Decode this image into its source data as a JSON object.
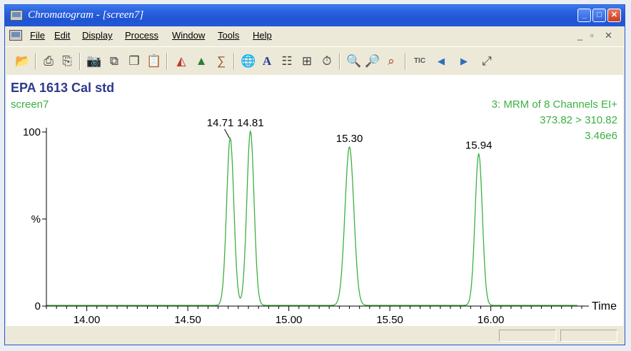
{
  "window": {
    "title": "Chromatogram - [screen7]"
  },
  "menu": [
    "File",
    "Edit",
    "Display",
    "Process",
    "Window",
    "Tools",
    "Help"
  ],
  "toolbar": [
    {
      "icon": "open-folder-icon",
      "glyph": "📂"
    },
    {
      "icon": "print-icon",
      "glyph": "⎙"
    },
    {
      "icon": "print-preview-icon",
      "glyph": "⎘"
    },
    {
      "icon": "camera-icon",
      "glyph": "📷"
    },
    {
      "icon": "copy-icon",
      "glyph": "⧉"
    },
    {
      "icon": "copy-list-icon",
      "glyph": "❐"
    },
    {
      "icon": "paste-icon",
      "glyph": "📋"
    },
    {
      "icon": "chromatogram-icon",
      "glyph": "◭"
    },
    {
      "icon": "peaks-icon",
      "glyph": "▲"
    },
    {
      "icon": "integrate-icon",
      "glyph": "∑"
    },
    {
      "icon": "globe-icon",
      "glyph": "🌐"
    },
    {
      "icon": "font-icon",
      "glyph": "A"
    },
    {
      "icon": "list-icon",
      "glyph": "☷"
    },
    {
      "icon": "tree-icon",
      "glyph": "⊞"
    },
    {
      "icon": "timer-icon",
      "glyph": "⏱"
    },
    {
      "icon": "zoom-in-icon",
      "glyph": "🔍"
    },
    {
      "icon": "zoom-out-icon",
      "glyph": "🔎"
    },
    {
      "icon": "zoom-reset-icon",
      "glyph": "⌕"
    },
    {
      "icon": "tic-icon",
      "glyph": "TIC"
    },
    {
      "icon": "arrow-left-icon",
      "glyph": "◀"
    },
    {
      "icon": "arrow-right-icon",
      "glyph": "▶"
    },
    {
      "icon": "fit-icon",
      "glyph": "⤢"
    }
  ],
  "plot": {
    "title": "EPA 1613 Cal std",
    "subtitle": "screen7",
    "info_line1": "3: MRM of 8 Channels EI+",
    "info_line2": "373.82 > 310.82",
    "info_line3": "3.46e6"
  },
  "chart_data": {
    "type": "line",
    "xlabel": "Time",
    "ylabel": "%",
    "xlim": [
      13.8,
      16.45
    ],
    "ylim": [
      0,
      100
    ],
    "x_ticks": [
      "14.00",
      "14.50",
      "15.00",
      "15.50",
      "16.00"
    ],
    "y_ticks": [
      "0",
      "%",
      "100"
    ],
    "grid": false,
    "colors": {
      "trace": "#3cb043",
      "info": "#3cb043",
      "title": "#2d3a8c"
    },
    "peaks": [
      {
        "label": "14.71",
        "rt": 14.71,
        "height": 96,
        "sigma": 0.018
      },
      {
        "label": "14.81",
        "rt": 14.81,
        "height": 100,
        "sigma": 0.018
      },
      {
        "label": "15.30",
        "rt": 15.3,
        "height": 91,
        "sigma": 0.022
      },
      {
        "label": "15.94",
        "rt": 15.94,
        "height": 87,
        "sigma": 0.018
      }
    ]
  },
  "statusbar": {
    "panels": [
      "",
      ""
    ]
  }
}
